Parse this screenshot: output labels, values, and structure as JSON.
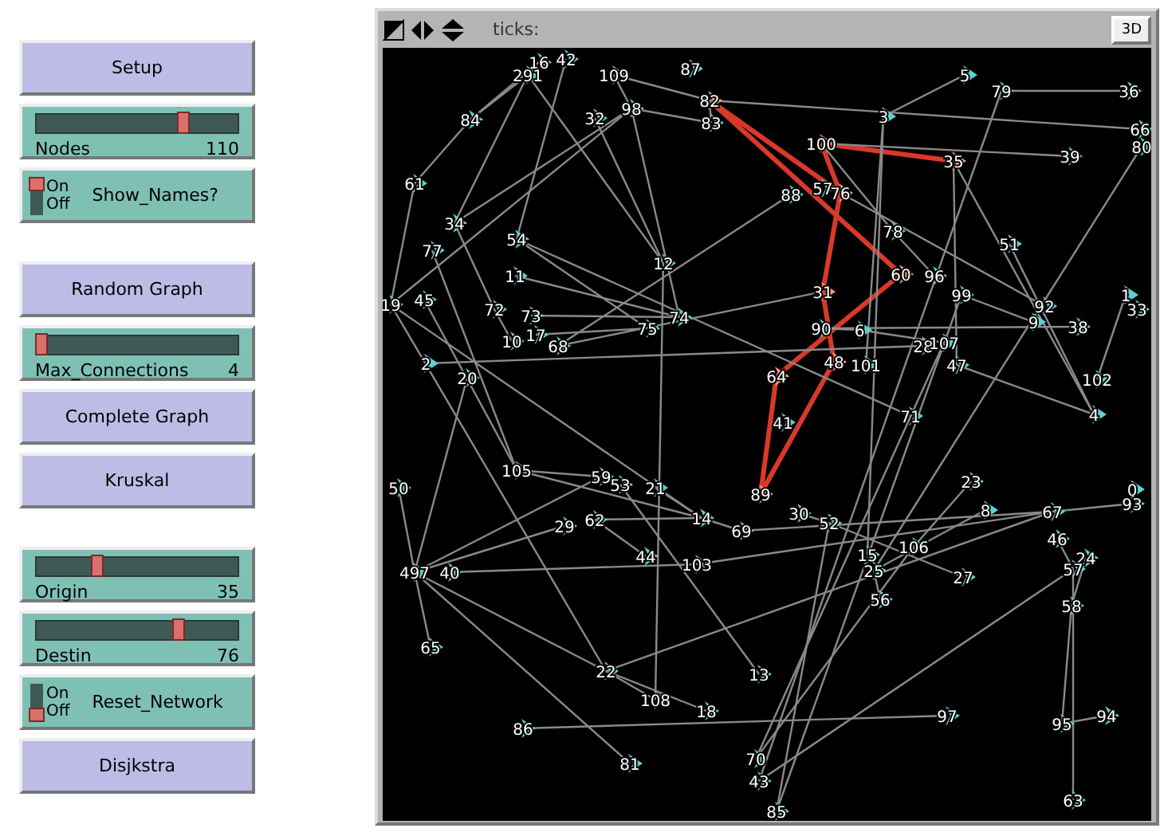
{
  "controls": [
    [
      {
        "kind": "button",
        "label": "Setup"
      },
      {
        "kind": "slider",
        "label": "Nodes",
        "value": "110",
        "level": 0.73
      },
      {
        "kind": "switch",
        "label": "Show_Names?",
        "on_label": "On",
        "off_label": "Off",
        "on": true
      }
    ],
    [
      {
        "kind": "button",
        "label": "Random Graph"
      },
      {
        "kind": "slider",
        "label": "Max_Connections",
        "value": "4",
        "level": 0.02
      },
      {
        "kind": "button",
        "label": "Complete Graph"
      },
      {
        "kind": "button",
        "label": "Kruskal"
      }
    ],
    [
      {
        "kind": "slider",
        "label": "Origin",
        "value": "35",
        "level": 0.3
      },
      {
        "kind": "slider",
        "label": "Destin",
        "value": "76",
        "level": 0.71
      },
      {
        "kind": "switch",
        "label": "Reset_Network",
        "on_label": "On",
        "off_label": "Off",
        "on": false
      },
      {
        "kind": "button",
        "label": "Disjkstra"
      }
    ]
  ],
  "view": {
    "ticks_label": "ticks:",
    "button_3d": "3D",
    "nodes": [
      {
        "label": "16",
        "highlighted": false
      },
      {
        "label": "42",
        "highlighted": false
      },
      {
        "label": "291",
        "highlighted": false
      },
      {
        "label": "109",
        "highlighted": false
      },
      {
        "label": "87",
        "highlighted": false
      },
      {
        "label": "82",
        "highlighted": true
      },
      {
        "label": "84",
        "highlighted": false
      },
      {
        "label": "32",
        "highlighted": false
      },
      {
        "label": "98",
        "highlighted": false
      },
      {
        "label": "83",
        "highlighted": false
      },
      {
        "label": "61",
        "highlighted": false
      },
      {
        "label": "34",
        "highlighted": false
      },
      {
        "label": "77",
        "highlighted": false
      },
      {
        "label": "54",
        "highlighted": false
      },
      {
        "label": "11",
        "highlighted": false
      },
      {
        "label": "12",
        "highlighted": false
      },
      {
        "label": "19",
        "highlighted": false
      },
      {
        "label": "45",
        "highlighted": false
      },
      {
        "label": "72",
        "highlighted": false
      },
      {
        "label": "73",
        "highlighted": false
      },
      {
        "label": "74",
        "highlighted": false
      },
      {
        "label": "75",
        "highlighted": false
      },
      {
        "label": "10",
        "highlighted": false
      },
      {
        "label": "17",
        "highlighted": false
      },
      {
        "label": "68",
        "highlighted": false
      },
      {
        "label": "2",
        "highlighted": false
      },
      {
        "label": "20",
        "highlighted": false
      },
      {
        "label": "5",
        "highlighted": false
      },
      {
        "label": "79",
        "highlighted": false
      },
      {
        "label": "36",
        "highlighted": false
      },
      {
        "label": "3",
        "highlighted": false
      },
      {
        "label": "66",
        "highlighted": false
      },
      {
        "label": "80",
        "highlighted": false
      },
      {
        "label": "100",
        "highlighted": true
      },
      {
        "label": "35",
        "highlighted": true
      },
      {
        "label": "39",
        "highlighted": false
      },
      {
        "label": "88",
        "highlighted": false
      },
      {
        "label": "57",
        "highlighted": false
      },
      {
        "label": "76",
        "highlighted": true
      },
      {
        "label": "78",
        "highlighted": false
      },
      {
        "label": "51",
        "highlighted": false
      },
      {
        "label": "60",
        "highlighted": true
      },
      {
        "label": "96",
        "highlighted": false
      },
      {
        "label": "31",
        "highlighted": true
      },
      {
        "label": "99",
        "highlighted": false
      },
      {
        "label": "92",
        "highlighted": false
      },
      {
        "label": "1",
        "highlighted": false
      },
      {
        "label": "33",
        "highlighted": false
      },
      {
        "label": "90",
        "highlighted": false
      },
      {
        "label": "6",
        "highlighted": false
      },
      {
        "label": "9",
        "highlighted": false
      },
      {
        "label": "38",
        "highlighted": false
      },
      {
        "label": "28",
        "highlighted": false
      },
      {
        "label": "107",
        "highlighted": false
      },
      {
        "label": "48",
        "highlighted": true
      },
      {
        "label": "101",
        "highlighted": false
      },
      {
        "label": "47",
        "highlighted": false
      },
      {
        "label": "64",
        "highlighted": true
      },
      {
        "label": "102",
        "highlighted": false
      },
      {
        "label": "4",
        "highlighted": false
      },
      {
        "label": "71",
        "highlighted": false
      },
      {
        "label": "41",
        "highlighted": false
      },
      {
        "label": "105",
        "highlighted": false
      },
      {
        "label": "50",
        "highlighted": false
      },
      {
        "label": "59",
        "highlighted": false
      },
      {
        "label": "53",
        "highlighted": false
      },
      {
        "label": "21",
        "highlighted": false
      },
      {
        "label": "89",
        "highlighted": true
      },
      {
        "label": "29",
        "highlighted": false
      },
      {
        "label": "62",
        "highlighted": false
      },
      {
        "label": "14",
        "highlighted": false
      },
      {
        "label": "69",
        "highlighted": false
      },
      {
        "label": "44",
        "highlighted": false
      },
      {
        "label": "103",
        "highlighted": false
      },
      {
        "label": "497",
        "highlighted": false
      },
      {
        "label": "40",
        "highlighted": false
      },
      {
        "label": "65",
        "highlighted": false
      },
      {
        "label": "22",
        "highlighted": false
      },
      {
        "label": "13",
        "highlighted": false
      },
      {
        "label": "108",
        "highlighted": false
      },
      {
        "label": "18",
        "highlighted": false
      },
      {
        "label": "86",
        "highlighted": false
      },
      {
        "label": "81",
        "highlighted": false
      },
      {
        "label": "70",
        "highlighted": false
      },
      {
        "label": "43",
        "highlighted": false
      },
      {
        "label": "85",
        "highlighted": false
      },
      {
        "label": "23",
        "highlighted": false
      },
      {
        "label": "0",
        "highlighted": false
      },
      {
        "label": "93",
        "highlighted": false
      },
      {
        "label": "30",
        "highlighted": false
      },
      {
        "label": "52",
        "highlighted": false
      },
      {
        "label": "8",
        "highlighted": false
      },
      {
        "label": "67",
        "highlighted": false
      },
      {
        "label": "15",
        "highlighted": false
      },
      {
        "label": "25",
        "highlighted": false
      },
      {
        "label": "106",
        "highlighted": false
      },
      {
        "label": "46",
        "highlighted": false
      },
      {
        "label": "24",
        "highlighted": false
      },
      {
        "label": "27",
        "highlighted": false
      },
      {
        "label": "57",
        "highlighted": false
      },
      {
        "label": "56",
        "highlighted": false
      },
      {
        "label": "58",
        "highlighted": false
      },
      {
        "label": "97",
        "highlighted": false
      },
      {
        "label": "95",
        "highlighted": false
      },
      {
        "label": "94",
        "highlighted": false
      },
      {
        "label": "63",
        "highlighted": false
      }
    ]
  }
}
